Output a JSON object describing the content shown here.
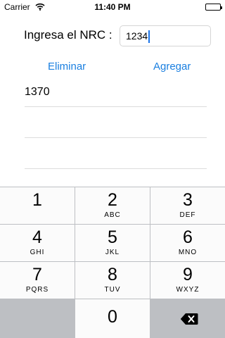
{
  "status_bar": {
    "carrier": "Carrier",
    "time": "11:40 PM",
    "wifi_icon": "wifi-icon",
    "battery_icon": "battery-icon"
  },
  "form": {
    "label": "Ingresa el NRC :",
    "input_value": "1234"
  },
  "actions": {
    "delete_label": "Eliminar",
    "add_label": "Agregar",
    "accent_color": "#1a7fe0"
  },
  "list": {
    "items": [
      "1370",
      "",
      ""
    ]
  },
  "keyboard": {
    "keys": [
      {
        "digit": "1",
        "letters": ""
      },
      {
        "digit": "2",
        "letters": "ABC"
      },
      {
        "digit": "3",
        "letters": "DEF"
      },
      {
        "digit": "4",
        "letters": "GHI"
      },
      {
        "digit": "5",
        "letters": "JKL"
      },
      {
        "digit": "6",
        "letters": "MNO"
      },
      {
        "digit": "7",
        "letters": "PQRS"
      },
      {
        "digit": "8",
        "letters": "TUV"
      },
      {
        "digit": "9",
        "letters": "WXYZ"
      },
      {
        "digit": "0",
        "letters": ""
      }
    ],
    "backspace_icon": "backspace-icon"
  }
}
